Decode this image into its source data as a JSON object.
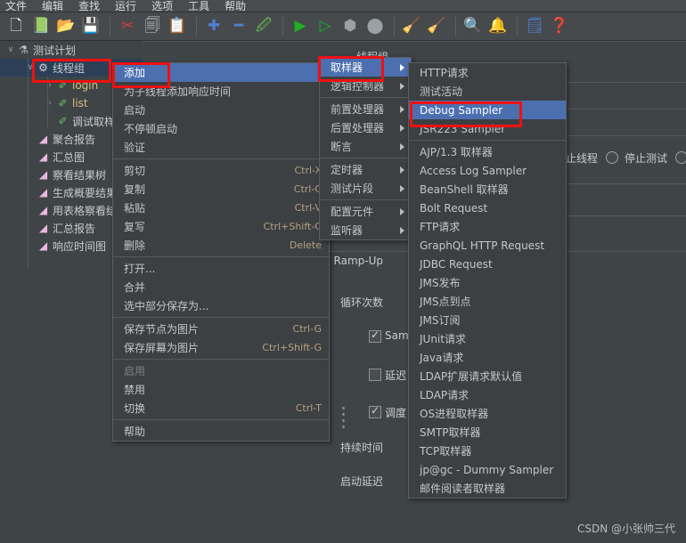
{
  "menubar": {
    "items": [
      "文件",
      "编辑",
      "查找",
      "运行",
      "选项",
      "工具",
      "帮助"
    ]
  },
  "toolbar": {
    "groups": [
      [
        {
          "name": "new-test-plan-icon",
          "glyph": "🗋"
        },
        {
          "name": "templates-icon",
          "glyph": "📗"
        },
        {
          "name": "open-icon",
          "glyph": "📂"
        },
        {
          "name": "save-icon",
          "glyph": "💾"
        }
      ],
      [
        {
          "name": "cut-icon",
          "glyph": "✂"
        },
        {
          "name": "copy-icon",
          "glyph": "🗐"
        },
        {
          "name": "paste-icon",
          "glyph": "📋"
        }
      ],
      [
        {
          "name": "expand-all-icon",
          "glyph": "✚"
        },
        {
          "name": "collapse-all-icon",
          "glyph": "━"
        },
        {
          "name": "toggle-icon",
          "glyph": "🖉"
        }
      ],
      [
        {
          "name": "start-icon",
          "glyph": "▶"
        },
        {
          "name": "start-no-pause-icon",
          "glyph": "▷"
        },
        {
          "name": "stop-icon",
          "glyph": "⬢"
        },
        {
          "name": "shutdown-icon",
          "glyph": "⬤"
        }
      ],
      [
        {
          "name": "clear-icon",
          "glyph": "🧹"
        },
        {
          "name": "clear-all-icon",
          "glyph": "🧹"
        }
      ],
      [
        {
          "name": "search-icon",
          "glyph": "🔍"
        },
        {
          "name": "reset-search-icon",
          "glyph": "🔔"
        }
      ],
      [
        {
          "name": "function-helper-icon",
          "glyph": "🗒"
        },
        {
          "name": "help-icon",
          "glyph": "❓"
        }
      ]
    ]
  },
  "tree": {
    "nodes": [
      {
        "label": "测试计划",
        "icon": "test-plan-icon",
        "depth": 0,
        "twisty": "open",
        "selected": false
      },
      {
        "label": "线程组",
        "icon": "thread-group-icon",
        "depth": 1,
        "twisty": "open",
        "selected": true
      },
      {
        "label": "login",
        "icon": "sampler-icon",
        "depth": 2,
        "twisty": "closed",
        "selected": false
      },
      {
        "label": "list",
        "icon": "sampler-icon",
        "depth": 2,
        "twisty": "closed",
        "selected": false
      },
      {
        "label": "调试取样器",
        "icon": "sampler-icon",
        "depth": 2,
        "twisty": "none",
        "selected": false
      },
      {
        "label": "聚合报告",
        "icon": "listener-icon",
        "depth": 1,
        "twisty": "none",
        "selected": false
      },
      {
        "label": "汇总图",
        "icon": "listener-icon",
        "depth": 1,
        "twisty": "none",
        "selected": false
      },
      {
        "label": "察看结果树",
        "icon": "listener-icon",
        "depth": 1,
        "twisty": "none",
        "selected": false
      },
      {
        "label": "生成概要结果",
        "icon": "listener-icon",
        "depth": 1,
        "twisty": "none",
        "selected": false
      },
      {
        "label": "用表格察看结果",
        "icon": "listener-icon",
        "depth": 1,
        "twisty": "none",
        "selected": false
      },
      {
        "label": "汇总报告",
        "icon": "listener-icon",
        "depth": 1,
        "twisty": "none",
        "selected": false
      },
      {
        "label": "响应时间图",
        "icon": "listener-icon",
        "depth": 1,
        "twisty": "none",
        "selected": false
      }
    ]
  },
  "thread_group_panel": {
    "title": "线程组",
    "on_error_stop_thread": "停止线程",
    "on_error_stop_test": "停止测试",
    "ramp_up_label": "Ramp-Up",
    "loop_count_label": "循环次数",
    "same_user_label": "Sam",
    "delay_label": "延迟",
    "scheduler_label": "调度",
    "duration_label": "持续时间",
    "startup_delay_label": "启动延迟"
  },
  "context_menu": {
    "items": [
      {
        "label": "添加",
        "accel": "",
        "submenu": true,
        "highlight": true,
        "disabled": false
      },
      {
        "label": "为子线程添加响应时间",
        "accel": "",
        "submenu": false,
        "highlight": false,
        "disabled": false
      },
      {
        "label": "启动",
        "accel": "",
        "submenu": false,
        "highlight": false,
        "disabled": false
      },
      {
        "label": "不停顿启动",
        "accel": "",
        "submenu": false,
        "highlight": false,
        "disabled": false
      },
      {
        "label": "验证",
        "accel": "",
        "submenu": false,
        "highlight": false,
        "disabled": false
      },
      {
        "separator": true
      },
      {
        "label": "剪切",
        "accel": "Ctrl-X",
        "submenu": false,
        "highlight": false,
        "disabled": false
      },
      {
        "label": "复制",
        "accel": "Ctrl-C",
        "submenu": false,
        "highlight": false,
        "disabled": false
      },
      {
        "label": "粘贴",
        "accel": "Ctrl-V",
        "submenu": false,
        "highlight": false,
        "disabled": false
      },
      {
        "label": "复写",
        "accel": "Ctrl+Shift-C",
        "submenu": false,
        "highlight": false,
        "disabled": false
      },
      {
        "label": "删除",
        "accel": "Delete",
        "submenu": false,
        "highlight": false,
        "disabled": false
      },
      {
        "separator": true
      },
      {
        "label": "打开...",
        "accel": "",
        "submenu": false,
        "highlight": false,
        "disabled": false
      },
      {
        "label": "合并",
        "accel": "",
        "submenu": false,
        "highlight": false,
        "disabled": false
      },
      {
        "label": "选中部分保存为...",
        "accel": "",
        "submenu": false,
        "highlight": false,
        "disabled": false
      },
      {
        "separator": true
      },
      {
        "label": "保存节点为图片",
        "accel": "Ctrl-G",
        "submenu": false,
        "highlight": false,
        "disabled": false
      },
      {
        "label": "保存屏幕为图片",
        "accel": "Ctrl+Shift-G",
        "submenu": false,
        "highlight": false,
        "disabled": false
      },
      {
        "separator": true
      },
      {
        "label": "启用",
        "accel": "",
        "submenu": false,
        "highlight": false,
        "disabled": true
      },
      {
        "label": "禁用",
        "accel": "",
        "submenu": false,
        "highlight": false,
        "disabled": false
      },
      {
        "label": "切换",
        "accel": "Ctrl-T",
        "submenu": false,
        "highlight": false,
        "disabled": false
      },
      {
        "separator": true
      },
      {
        "label": "帮助",
        "accel": "",
        "submenu": false,
        "highlight": false,
        "disabled": false
      }
    ]
  },
  "add_submenu": {
    "items": [
      {
        "label": "取样器",
        "submenu": true,
        "highlight": true
      },
      {
        "label": "逻辑控制器",
        "submenu": true,
        "highlight": false
      },
      {
        "separator": true
      },
      {
        "label": "前置处理器",
        "submenu": true,
        "highlight": false
      },
      {
        "label": "后置处理器",
        "submenu": true,
        "highlight": false
      },
      {
        "label": "断言",
        "submenu": true,
        "highlight": false
      },
      {
        "separator": true
      },
      {
        "label": "定时器",
        "submenu": true,
        "highlight": false
      },
      {
        "label": "测试片段",
        "submenu": true,
        "highlight": false
      },
      {
        "separator": true
      },
      {
        "label": "配置元件",
        "submenu": true,
        "highlight": false
      },
      {
        "label": "监听器",
        "submenu": true,
        "highlight": false
      }
    ]
  },
  "sampler_submenu": {
    "items": [
      {
        "label": "HTTP请求",
        "highlight": false
      },
      {
        "label": "测试活动",
        "highlight": false
      },
      {
        "label": "Debug Sampler",
        "highlight": true
      },
      {
        "label": "JSR223 Sampler",
        "highlight": false
      },
      {
        "separator": true
      },
      {
        "label": "AJP/1.3 取样器",
        "highlight": false
      },
      {
        "label": "Access Log Sampler",
        "highlight": false
      },
      {
        "label": "BeanShell 取样器",
        "highlight": false
      },
      {
        "label": "Bolt Request",
        "highlight": false
      },
      {
        "label": "FTP请求",
        "highlight": false
      },
      {
        "label": "GraphQL HTTP Request",
        "highlight": false
      },
      {
        "label": "JDBC Request",
        "highlight": false
      },
      {
        "label": "JMS发布",
        "highlight": false
      },
      {
        "label": "JMS点到点",
        "highlight": false
      },
      {
        "label": "JMS订阅",
        "highlight": false
      },
      {
        "label": "JUnit请求",
        "highlight": false
      },
      {
        "label": "Java请求",
        "highlight": false
      },
      {
        "label": "LDAP扩展请求默认值",
        "highlight": false
      },
      {
        "label": "LDAP请求",
        "highlight": false
      },
      {
        "label": "OS进程取样器",
        "highlight": false
      },
      {
        "label": "SMTP取样器",
        "highlight": false
      },
      {
        "label": "TCP取样器",
        "highlight": false
      },
      {
        "label": "jp@gc - Dummy Sampler",
        "highlight": false
      },
      {
        "label": "邮件阅读者取样器",
        "highlight": false
      }
    ]
  },
  "annotations": {
    "highlight_color": "#ee1111",
    "boxes": [
      "thread-group-node",
      "add-menu-item",
      "sampler-submenu-item",
      "debug-sampler-item"
    ]
  },
  "watermark": "CSDN @小张帅三代"
}
